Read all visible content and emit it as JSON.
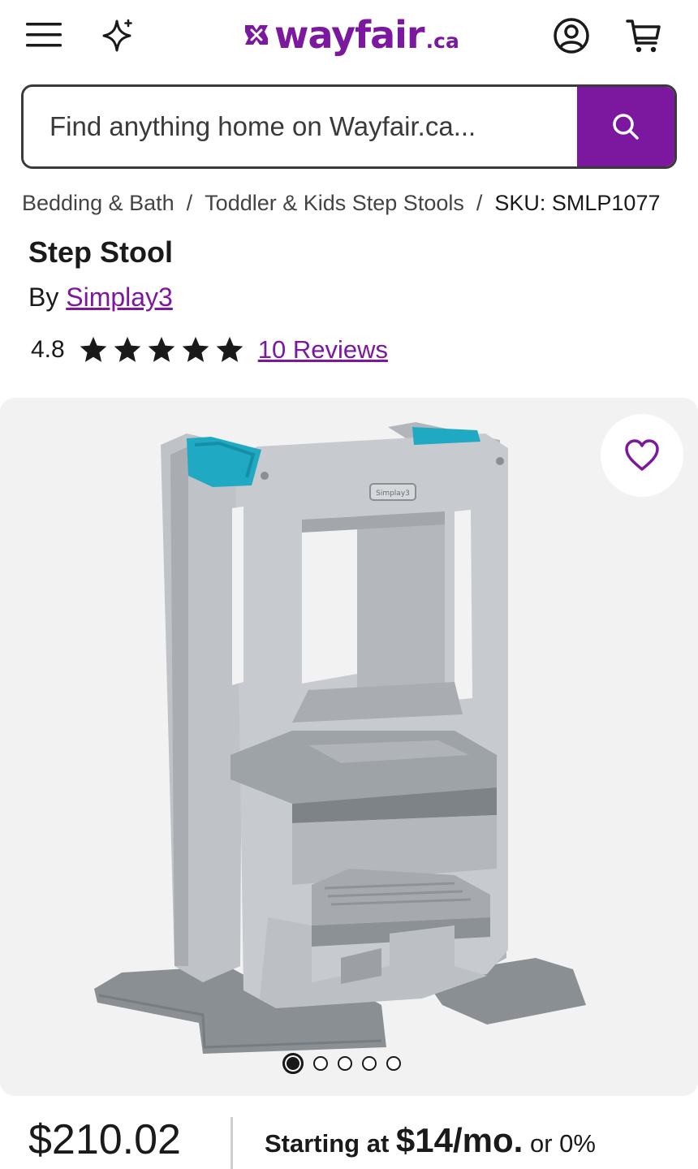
{
  "header": {
    "logo_text": "wayfair",
    "logo_suffix": ".ca",
    "brand_color": "#7b189f",
    "icons": [
      "hamburger-menu-icon",
      "sparkle-icon",
      "account-icon",
      "cart-icon"
    ]
  },
  "search": {
    "placeholder": "Find anything home on Wayfair.ca...",
    "button_icon": "search-icon"
  },
  "breadcrumb": {
    "items": [
      "Bedding & Bath",
      "Toddler & Kids Step Stools"
    ],
    "separator": "/",
    "sku": "SKU: SMLP1077"
  },
  "product": {
    "title": "Step Stool",
    "by_prefix": "By",
    "brand": "Simplay3",
    "image_logo": "Simplay3",
    "rating": "4.8",
    "rating_value": 4.8,
    "stars_total": 5,
    "reviews_link": "10 Reviews"
  },
  "gallery": {
    "image_count": 5,
    "active_index": 0,
    "favorite_icon": "heart-icon",
    "accent_color": "#1fa9c3"
  },
  "pricing": {
    "price": "$210.02",
    "financing_prefix": "Starting at",
    "financing_amount": "$14/mo.",
    "financing_suffix": "or 0%"
  }
}
